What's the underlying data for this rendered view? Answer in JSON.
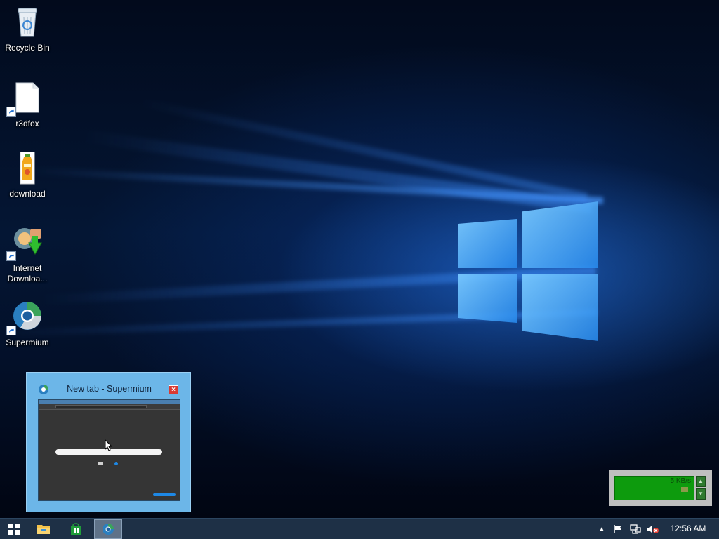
{
  "desktop": {
    "icons": [
      {
        "label": "Recycle Bin",
        "icon": "recycle-bin-icon"
      },
      {
        "label": "r3dfox",
        "icon": "blank-file-icon"
      },
      {
        "label": "download",
        "icon": "juice-bottle-icon"
      },
      {
        "label": "Internet Downloa...",
        "icon": "internet-download-manager-icon"
      },
      {
        "label": "Supermium",
        "icon": "supermium-browser-icon"
      }
    ]
  },
  "taskbar_preview": {
    "title": "New tab - Supermium",
    "close_label": "×"
  },
  "net_monitor": {
    "speed": "5 KB/s"
  },
  "taskbar": {
    "start_icon": "windows-start-icon",
    "pinned": [
      {
        "icon": "file-explorer-icon"
      },
      {
        "icon": "store-icon"
      },
      {
        "icon": "supermium-browser-icon",
        "active": true
      }
    ],
    "tray": {
      "clock": "12:56 AM",
      "icons": [
        "show-hidden-icons-chevron",
        "action-center-flag-icon",
        "network-icon",
        "volume-muted-icon"
      ]
    }
  },
  "colors": {
    "taskbar": "#1e3046",
    "preview_bg": "#6cb6e8",
    "netmon_graph": "#0d9b0d"
  }
}
